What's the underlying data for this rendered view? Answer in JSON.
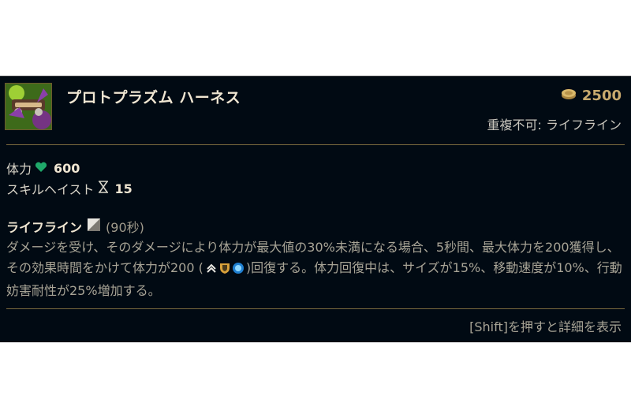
{
  "item": {
    "name": "プロトプラズム ハーネス",
    "cost": "2500",
    "unique": "重複不可: ライフライン",
    "icon": "protoplasm-harness-icon"
  },
  "stats": [
    {
      "label": "体力",
      "icon": "heart-icon",
      "value": "600"
    },
    {
      "label": "スキルヘイスト",
      "icon": "hourglass-icon",
      "value": "15"
    }
  ],
  "passive": {
    "name": "ライフライン",
    "cooldown": "(90秒)",
    "desc_part1": "ダメージを受け、そのダメージにより体力が最大値の30%未満になる場合、5秒間、最大体力を200獲得し、その効果時間をかけて体力が200 (",
    "desc_part2": ")回復する。体力回復中は、サイズが15%、移動速度が10%、行動妨害耐性が25%増加する。"
  },
  "footer": "[Shift]を押すと詳細を表示",
  "colors": {
    "background": "#010a13",
    "gold": "#c8aa6e",
    "heart": "#1fa86a",
    "text": "#f0e6d2"
  }
}
